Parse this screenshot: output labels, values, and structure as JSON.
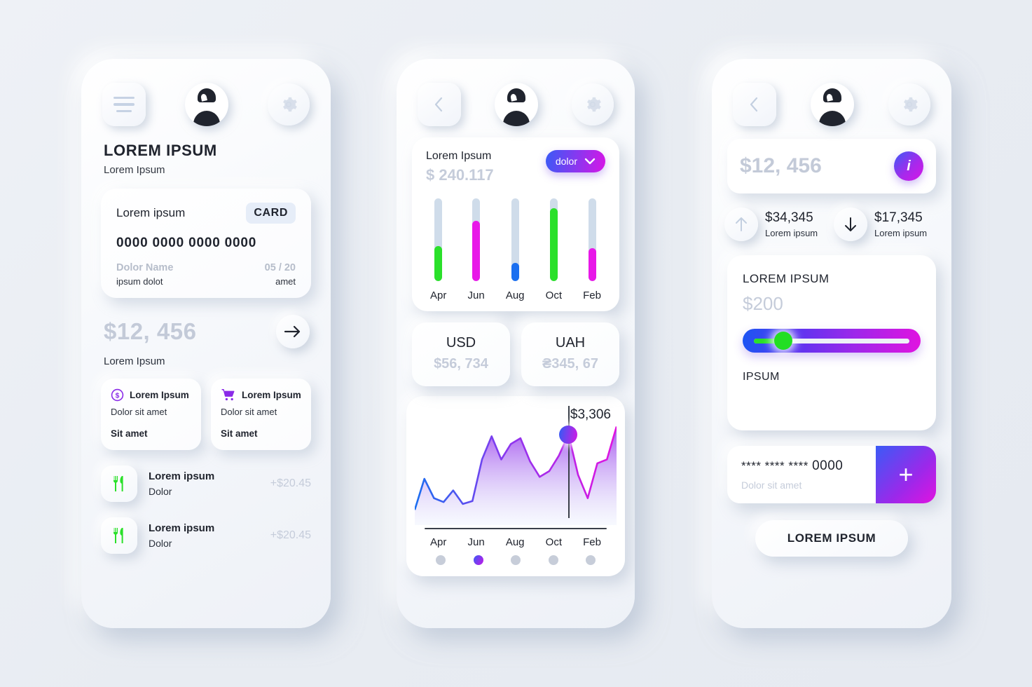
{
  "screen1": {
    "header": {
      "menu_icon": "hamburger-menu-icon",
      "avatar_icon": "user-avatar-icon",
      "settings_icon": "gear-icon"
    },
    "title": "LOREM IPSUM",
    "subtitle": "Lorem Ipsum",
    "card": {
      "label": "Lorem ipsum",
      "chip": "CARD",
      "number": "0000 0000 0000 0000",
      "holder_label": "Dolor Name",
      "expiry_label": "05 / 20",
      "holder_value": "ipsum dolot",
      "expiry_value": "amet"
    },
    "balance": {
      "amount": "$12, 456",
      "caption": "Lorem Ipsum",
      "arrow_icon": "arrow-right-icon"
    },
    "mini_cards": [
      {
        "icon": "dollar-circle-icon",
        "title": "Lorem Ipsum",
        "subtitle": "Dolor sit amet",
        "footer": "Sit amet"
      },
      {
        "icon": "shopping-cart-icon",
        "title": "Lorem Ipsum",
        "subtitle": "Dolor sit amet",
        "footer": "Sit amet"
      }
    ],
    "transactions": [
      {
        "icon": "cutlery-icon",
        "title": "Lorem ipsum",
        "subtitle": "Dolor",
        "amount": "+$20.45"
      },
      {
        "icon": "cutlery-icon",
        "title": "Lorem ipsum",
        "subtitle": "Dolor",
        "amount": "+$20.45"
      }
    ]
  },
  "screen2": {
    "header": {
      "back_icon": "chevron-left-icon",
      "avatar_icon": "user-avatar-icon",
      "settings_icon": "gear-icon"
    },
    "stats": {
      "title": "Lorem Ipsum",
      "amount": "$ 240.117",
      "dropdown_label": "dolor",
      "dropdown_icon": "chevron-down-icon"
    },
    "currencies": [
      {
        "code": "USD",
        "value": "$56, 734"
      },
      {
        "code": "UAH",
        "value": "₴345, 67"
      }
    ],
    "line_chart": {
      "callout": "$3,306"
    }
  },
  "screen3": {
    "header": {
      "back_icon": "chevron-left-icon",
      "avatar_icon": "user-avatar-icon",
      "settings_icon": "gear-icon"
    },
    "balance": {
      "amount": "$12, 456",
      "info_icon": "info-icon",
      "info_glyph": "i"
    },
    "flows": [
      {
        "icon": "arrow-up-icon",
        "value": "$34,345",
        "label": "Lorem ipsum"
      },
      {
        "icon": "arrow-down-icon",
        "value": "$17,345",
        "label": "Lorem ipsum"
      }
    ],
    "slider_card": {
      "title": "LOREM IPSUM",
      "amount": "$200",
      "footer": "IPSUM",
      "value_percent": 23
    },
    "add_card": {
      "masked": "**** **** ****",
      "last4": "0000",
      "subtitle": "Dolor sit amet",
      "plus_glyph": "+"
    },
    "cta": "LOREM IPSUM"
  },
  "chart_data": [
    {
      "type": "bar",
      "title": "Lorem Ipsum",
      "subtitle": "$ 240.117",
      "categories": [
        "Apr",
        "Jun",
        "Aug",
        "Oct",
        "Feb"
      ],
      "values": [
        42,
        73,
        22,
        88,
        40
      ],
      "colors": [
        "#2ae02a",
        "#e818e8",
        "#1a6ff0",
        "#2ae02a",
        "#e818e8"
      ],
      "track_color": "#cfdcea",
      "ylim": [
        0,
        100
      ],
      "ylabel": "",
      "xlabel": "",
      "grid": false,
      "legend": "none"
    },
    {
      "type": "area",
      "title": "",
      "x": [
        0,
        1,
        2,
        3,
        4,
        5,
        6,
        7,
        8,
        9,
        10,
        11,
        12,
        13,
        14,
        15,
        16,
        17,
        18,
        19,
        20
      ],
      "values": [
        10,
        42,
        22,
        18,
        30,
        16,
        19,
        62,
        86,
        62,
        78,
        84,
        60,
        44,
        50,
        66,
        88,
        46,
        22,
        58,
        62,
        96
      ],
      "annotation": "$3,306",
      "annotation_index": 16,
      "tick_labels": [
        "Apr",
        "Jun",
        "Aug",
        "Oct",
        "Feb"
      ],
      "dots_active_index": 1,
      "ylim": [
        0,
        100
      ],
      "grid": false,
      "legend": "none",
      "line_gradient": [
        "#1a6ff0",
        "#8a37ef",
        "#e113e0"
      ]
    }
  ],
  "palette": {
    "bg": "#e9edf3",
    "accent_blue": "#3a5bf6",
    "accent_purple": "#9c28ea",
    "accent_magenta": "#e113e0",
    "accent_green": "#2ae02a",
    "text_dark": "#20242e",
    "text_muted": "#c5ccda"
  }
}
